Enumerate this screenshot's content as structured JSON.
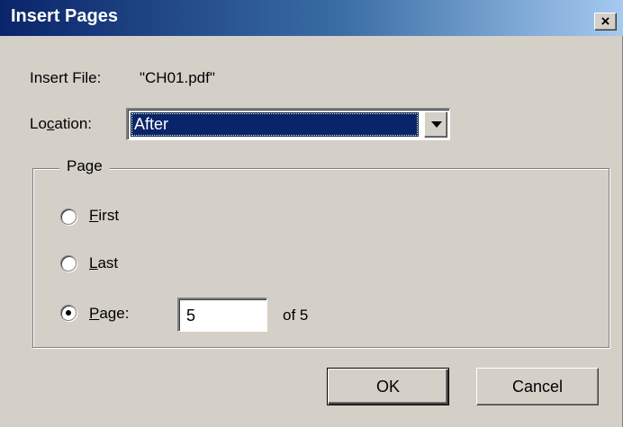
{
  "dialog": {
    "title": "Insert Pages",
    "close_glyph": "×"
  },
  "insert_file": {
    "label": "Insert File:",
    "value": "\"CH01.pdf\""
  },
  "location": {
    "label_pre": "Lo",
    "label_mnemonic": "c",
    "label_post": "ation:",
    "selected": "After"
  },
  "page_group": {
    "legend": "Page",
    "radios": [
      {
        "mnemonic": "F",
        "rest": "irst",
        "checked": false
      },
      {
        "mnemonic": "L",
        "rest": "ast",
        "checked": false
      },
      {
        "mnemonic": "P",
        "rest": "age:",
        "checked": true
      }
    ],
    "page_value": "5",
    "of_text": "of 5"
  },
  "buttons": {
    "ok": "OK",
    "cancel": "Cancel"
  },
  "colors": {
    "title_start": "#0a246a",
    "title_end": "#a6caf0",
    "face": "#d4d0c8",
    "selection": "#0a246a"
  }
}
